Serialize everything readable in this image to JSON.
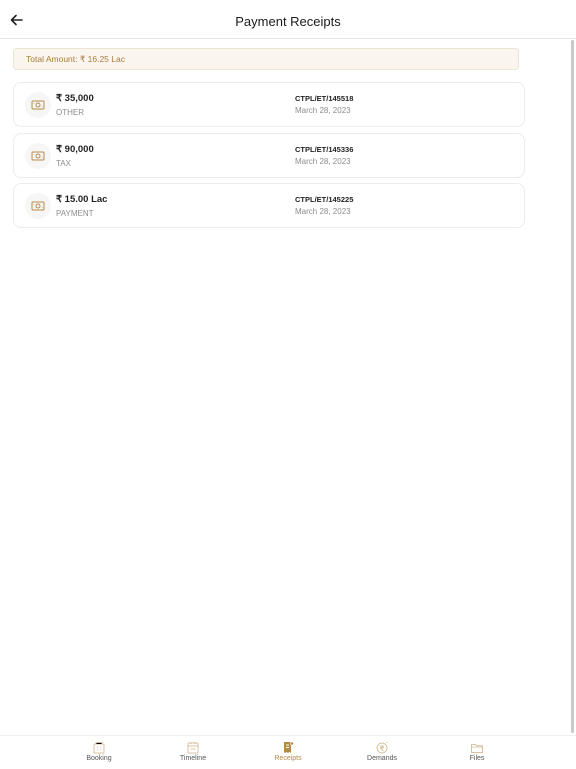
{
  "header": {
    "title": "Payment Receipts"
  },
  "summary": {
    "total_label": "Total Amount: ₹ 16.25 Lac"
  },
  "receipts": [
    {
      "amount": "₹ 35,000",
      "type": "OTHER",
      "ref": "CTPL/ET/145518",
      "date": "March 28, 2023"
    },
    {
      "amount": "₹ 90,000",
      "type": "TAX",
      "ref": "CTPL/ET/145336",
      "date": "March 28, 2023"
    },
    {
      "amount": "₹ 15.00 Lac",
      "type": "PAYMENT",
      "ref": "CTPL/ET/145225",
      "date": "March 28, 2023"
    }
  ],
  "tabs": [
    {
      "label": "Booking",
      "icon": "building-icon"
    },
    {
      "label": "Timeline",
      "icon": "calendar-icon"
    },
    {
      "label": "Receipts",
      "icon": "receipt-icon",
      "active": true
    },
    {
      "label": "Demands",
      "icon": "rupee-coin-icon"
    },
    {
      "label": "Files",
      "icon": "folder-icon"
    }
  ],
  "colors": {
    "accent": "#b58a47",
    "total_bg": "#faf5ee",
    "total_text": "#a97c3e"
  }
}
